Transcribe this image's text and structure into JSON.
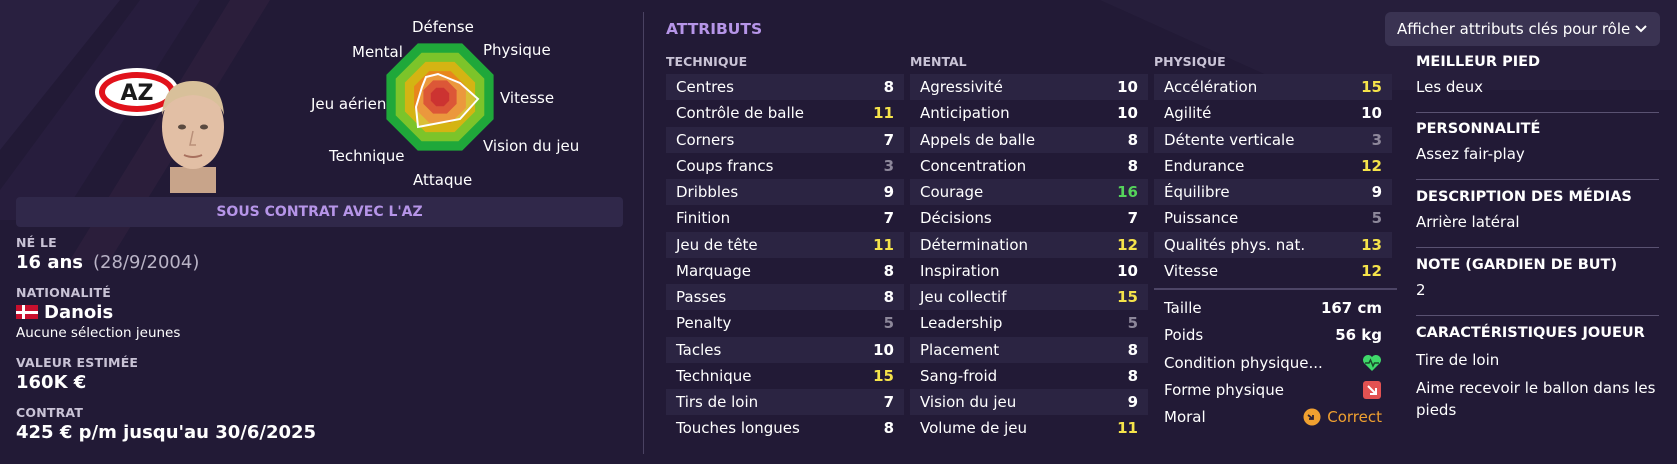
{
  "player": {
    "contract_banner": "SOUS CONTRAT AVEC L'AZ",
    "born_label": "NÉ LE",
    "age": "16 ans",
    "birth_date": "(28/9/2004)",
    "nationality_label": "NATIONALITÉ",
    "nationality": "Danois",
    "caps": "Aucune sélection jeunes",
    "value_label": "VALEUR ESTIMÉE",
    "value": "160K €",
    "contract_label": "CONTRAT",
    "contract": "425 € p/m jusqu'au 30/6/2025",
    "club_logo_text": "AZ"
  },
  "radar": {
    "labels": {
      "defense": "Défense",
      "physique": "Physique",
      "vitesse": "Vitesse",
      "vision": "Vision du jeu",
      "attaque": "Attaque",
      "technique": "Technique",
      "jeu_aerien": "Jeu aérien",
      "mental": "Mental"
    },
    "ring_colors": [
      "#1fa83a",
      "#7cc42a",
      "#d4b413",
      "#e8861c",
      "#d63a15",
      "#c4100e"
    ]
  },
  "attributes": {
    "title": "ATTRIBUTS",
    "dropdown": "Afficher attributs clés pour rôle",
    "technique_header": "TECHNIQUE",
    "mental_header": "MENTAL",
    "physique_header": "PHYSIQUE",
    "technique": [
      {
        "name": "Centres",
        "value": "8",
        "tier": "mid"
      },
      {
        "name": "Contrôle de balle",
        "value": "11",
        "tier": "good"
      },
      {
        "name": "Corners",
        "value": "7",
        "tier": "mid"
      },
      {
        "name": "Coups francs",
        "value": "3",
        "tier": "low"
      },
      {
        "name": "Dribbles",
        "value": "9",
        "tier": "mid"
      },
      {
        "name": "Finition",
        "value": "7",
        "tier": "mid"
      },
      {
        "name": "Jeu de tête",
        "value": "11",
        "tier": "good"
      },
      {
        "name": "Marquage",
        "value": "8",
        "tier": "mid"
      },
      {
        "name": "Passes",
        "value": "8",
        "tier": "mid"
      },
      {
        "name": "Penalty",
        "value": "5",
        "tier": "low"
      },
      {
        "name": "Tacles",
        "value": "10",
        "tier": "mid"
      },
      {
        "name": "Technique",
        "value": "15",
        "tier": "good"
      },
      {
        "name": "Tirs de loin",
        "value": "7",
        "tier": "mid"
      },
      {
        "name": "Touches longues",
        "value": "8",
        "tier": "mid"
      }
    ],
    "mental": [
      {
        "name": "Agressivité",
        "value": "10",
        "tier": "mid"
      },
      {
        "name": "Anticipation",
        "value": "10",
        "tier": "mid"
      },
      {
        "name": "Appels de balle",
        "value": "8",
        "tier": "mid"
      },
      {
        "name": "Concentration",
        "value": "8",
        "tier": "mid"
      },
      {
        "name": "Courage",
        "value": "16",
        "tier": "high"
      },
      {
        "name": "Décisions",
        "value": "7",
        "tier": "mid"
      },
      {
        "name": "Détermination",
        "value": "12",
        "tier": "good"
      },
      {
        "name": "Inspiration",
        "value": "10",
        "tier": "mid"
      },
      {
        "name": "Jeu collectif",
        "value": "15",
        "tier": "good"
      },
      {
        "name": "Leadership",
        "value": "5",
        "tier": "low"
      },
      {
        "name": "Placement",
        "value": "8",
        "tier": "mid"
      },
      {
        "name": "Sang-froid",
        "value": "8",
        "tier": "mid"
      },
      {
        "name": "Vision du jeu",
        "value": "9",
        "tier": "mid"
      },
      {
        "name": "Volume de jeu",
        "value": "11",
        "tier": "good"
      }
    ],
    "physique": [
      {
        "name": "Accélération",
        "value": "15",
        "tier": "good"
      },
      {
        "name": "Agilité",
        "value": "10",
        "tier": "mid"
      },
      {
        "name": "Détente verticale",
        "value": "3",
        "tier": "low"
      },
      {
        "name": "Endurance",
        "value": "12",
        "tier": "good"
      },
      {
        "name": "Équilibre",
        "value": "9",
        "tier": "mid"
      },
      {
        "name": "Puissance",
        "value": "5",
        "tier": "low"
      },
      {
        "name": "Qualités phys. nat.",
        "value": "13",
        "tier": "good"
      },
      {
        "name": "Vitesse",
        "value": "12",
        "tier": "good"
      }
    ],
    "height_label": "Taille",
    "height": "167 cm",
    "weight_label": "Poids",
    "weight": "56 kg",
    "condition_label": "Condition physique...",
    "form_label": "Forme physique",
    "morale_label": "Moral",
    "morale": "Correct",
    "colors": {
      "low": "#8d879a",
      "good": "#f5e34a",
      "high": "#55d45b",
      "accent": "#b695e8"
    }
  },
  "side": {
    "foot_label": "MEILLEUR PIED",
    "foot": "Les deux",
    "personality_label": "PERSONNALITÉ",
    "personality": "Assez fair-play",
    "media_label": "DESCRIPTION DES MÉDIAS",
    "media": "Arrière latéral",
    "gk_label": "NOTE (GARDIEN DE BUT)",
    "gk": "2",
    "traits_label": "CARACTÉRISTIQUES JOUEUR",
    "traits": [
      "Tire de loin",
      "Aime recevoir le ballon dans les pieds"
    ]
  }
}
